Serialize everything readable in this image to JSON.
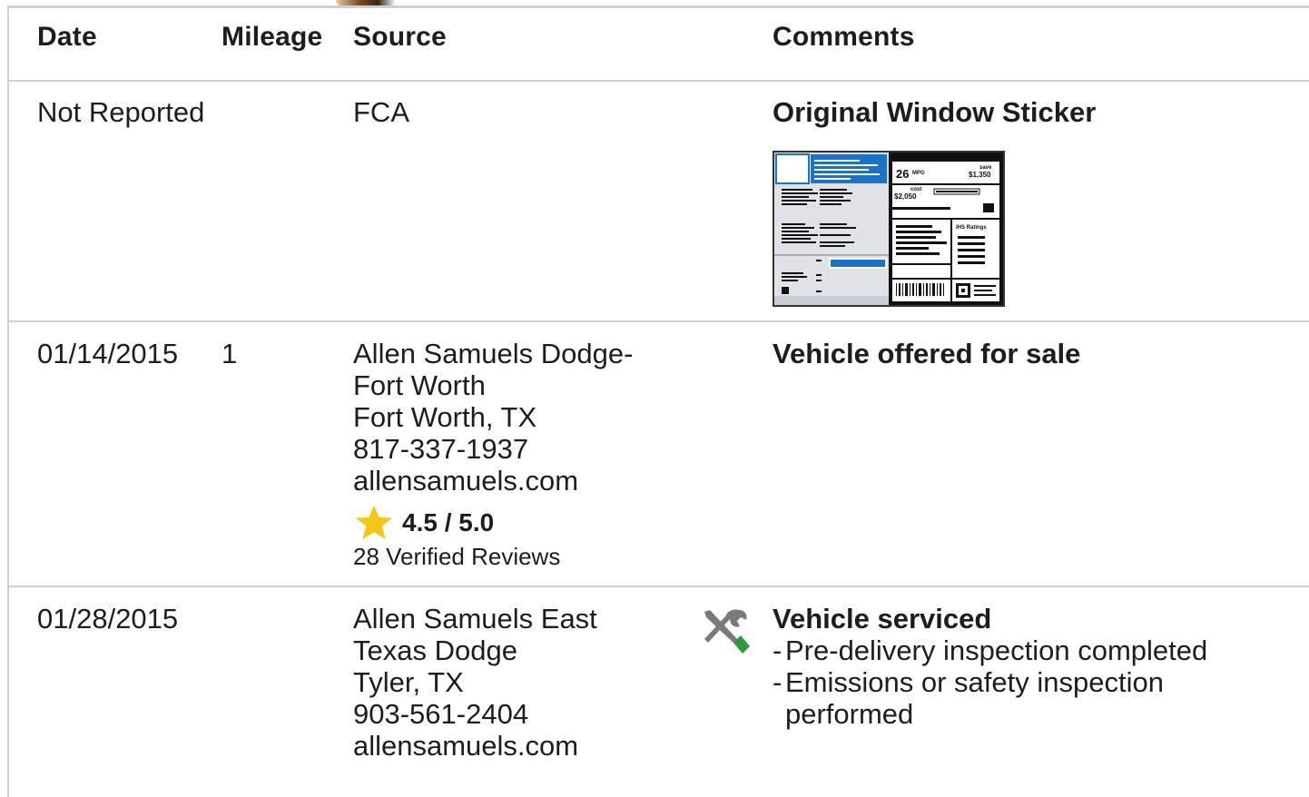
{
  "table": {
    "headers": {
      "date": "Date",
      "mileage": "Mileage",
      "source": "Source",
      "comments": "Comments"
    },
    "rows": [
      {
        "date": "Not Reported",
        "mileage": "",
        "source": [
          "FCA"
        ],
        "comment_title": "Original Window Sticker",
        "comment_items": [],
        "icon": "window-sticker-thumbnail"
      },
      {
        "date": "01/14/2015",
        "mileage": "1",
        "source": [
          "Allen Samuels Dodge-",
          "Fort Worth",
          "Fort Worth, TX",
          "817-337-1937",
          "allensamuels.com"
        ],
        "rating": {
          "value": "4.5 / 5.0",
          "reviews": "28 Verified Reviews",
          "icon": "star-icon",
          "color": "#f5c518"
        },
        "comment_title": "Vehicle offered for sale",
        "comment_items": []
      },
      {
        "date": "01/28/2015",
        "mileage": "",
        "source": [
          "Allen Samuels East",
          "Texas Dodge",
          "Tyler, TX",
          "903-561-2404",
          "allensamuels.com"
        ],
        "comment_title": "Vehicle serviced",
        "comment_items": [
          "Pre-delivery inspection completed",
          "Emissions or safety inspection",
          "performed"
        ],
        "icon": "service-tools-icon"
      }
    ]
  },
  "sticker": {
    "mpg": "26",
    "mpg_unit": "MPG",
    "save_label": "save",
    "save_value": "$1,350",
    "cost_label": "cost",
    "cost_value": "$2,050",
    "ratings_label": "IHS Ratings"
  },
  "colors": {
    "accent_blue": "#1a73c9",
    "border": "#cfcfcf",
    "star": "#f5c518",
    "wrench_green": "#2a9a3a",
    "icon_gray": "#7a7a7a"
  }
}
